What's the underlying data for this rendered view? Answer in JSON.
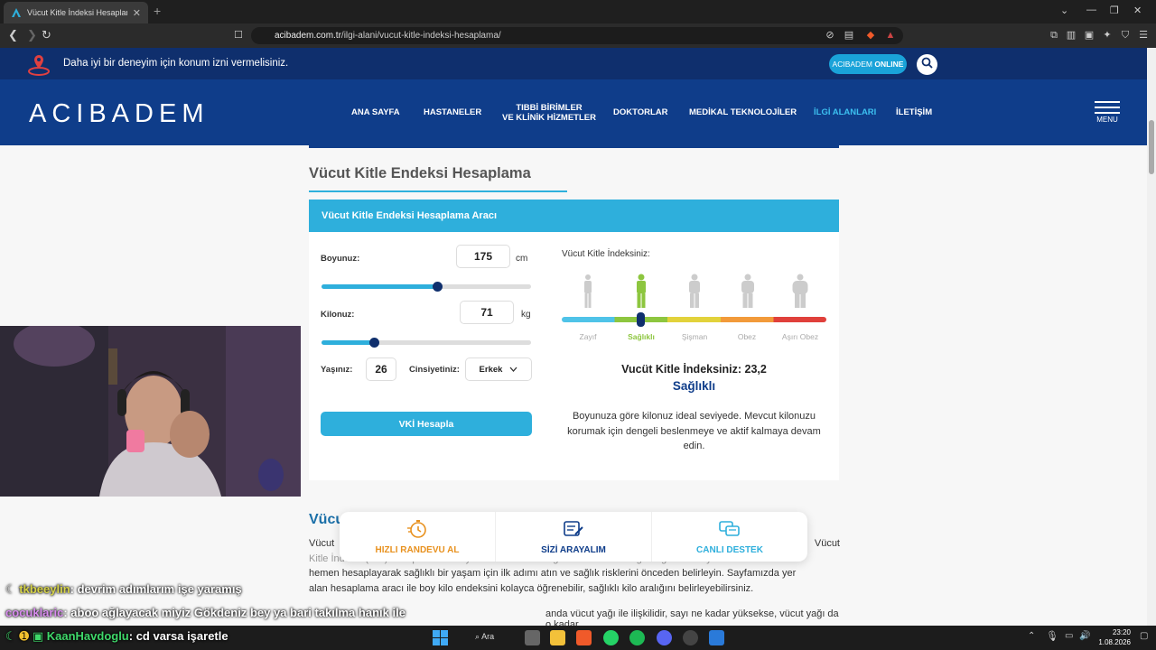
{
  "browser": {
    "tab_title": "Vücut Kitle İndeksi Hesaplama -",
    "url_prefix": "acibadem.com.tr",
    "url_path": "/ilgi-alani/vucut-kitle-indeksi-hesaplama/"
  },
  "location_bar": {
    "message": "Daha iyi bir deneyim için konum izni vermelisiniz.",
    "online_label_a": "ACIBADEM ",
    "online_label_b": "ONLINE"
  },
  "site": {
    "logo": "ACIBADEM",
    "nav": [
      "ANA SAYFA",
      "HASTANELER",
      "TIBBİ BİRİMLER",
      "VE KLİNİK HİZMETLER",
      "DOKTORLAR",
      "MEDİKAL TEKNOLOJİLER",
      "İLGİ ALANLARI",
      "İLETİŞİM"
    ],
    "menu_label": "MENU"
  },
  "page": {
    "title": "Vücut Kitle Endeksi Hesaplama",
    "card_title": "Vücut Kitle Endeksi Hesaplama Aracı",
    "height_label": "Boyunuz:",
    "height_value": "175",
    "height_unit": "cm",
    "height_slider": 0.55,
    "weight_label": "Kilonuz:",
    "weight_value": "71",
    "weight_unit": "kg",
    "weight_slider": 0.25,
    "age_label": "Yaşınız:",
    "age_value": "26",
    "gender_label": "Cinsiyetiniz:",
    "gender_value": "Erkek",
    "calc_button": "VKİ Hesapla",
    "index_heading": "Vücut Kitle İndeksiniz:",
    "categories": [
      "Zayıf",
      "Sağlıklı",
      "Şişman",
      "Obez",
      "Aşırı Obez"
    ],
    "result_line": "Vucüt Kitle İndeksiniz: 23,2",
    "result_status": "Sağlıklı",
    "result_desc": "Boyunuza göre kilonuz ideal seviyede. Mevcut kilonuzu korumak için dengeli beslenmeye ve aktif kalmaya devam edin.",
    "section_title_partial": "Vücu",
    "para_start": "Vücut",
    "para_right": "Vücut",
    "para_line2": "Kitle İndeksi (VKİ) hesaplama ile boyunuza ve kilonuza göre ideal kilo aralığını öğrenin. Boy kilo endeksini",
    "para_line3": "hemen hesaplayarak sağlıklı bir yaşam için ilk adımı atın ve sağlık risklerini önceden belirleyin. Sayfamızda yer",
    "para_line4": "alan hesaplama aracı ile boy kilo endeksini kolayca öğrenebilir, sağlıklı kilo aralığını belirleyebilirsiniz.",
    "para_line5": "anda vücut yağı ile ilişkilidir, sayı ne kadar yüksekse, vücut yağı da o kadar"
  },
  "quick_actions": [
    "HIZLI RANDEVU AL",
    "SİZİ ARAYALIM",
    "CANLI DESTEK"
  ],
  "chat": [
    {
      "user": "tkbeeylin",
      "text": ": devrim adımlarım işe yaramış",
      "color": "#e6e04a"
    },
    {
      "user": "cocuklaric",
      "text": ": aboo ağlayacak miyiz Gökdeniz bey ya bari takılma hanık ile"
    },
    {
      "user": "KaanHavdoglu",
      "text": ": cd varsa işaretle",
      "color": "#3fd86a"
    }
  ],
  "taskbar": {
    "search": "Ara",
    "time": "23:20",
    "date": "1.08.2026"
  }
}
